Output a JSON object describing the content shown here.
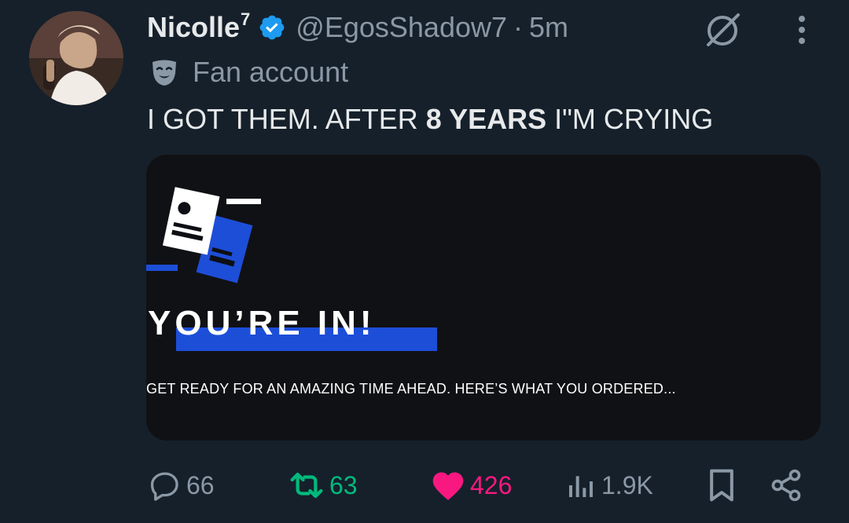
{
  "tweet": {
    "author": {
      "name": "Nicolle",
      "name_sup": "7",
      "handle": "@EgosShadow7",
      "separator": "·",
      "time": "5m"
    },
    "label": "Fan account",
    "text": {
      "before": "I GOT THEM. AFTER ",
      "bold": "8 YEARS",
      "after": " I\"M CRYING"
    },
    "card": {
      "title": "YOU’RE IN!",
      "subtitle": "GET READY FOR AN AMAZING TIME AHEAD. HERE’S WHAT YOU ORDERED..."
    },
    "metrics": {
      "replies": "66",
      "retweets": "63",
      "likes": "426",
      "views": "1.9K"
    }
  },
  "icons": {
    "verified": "verified-badge-icon",
    "grok": "grok-icon",
    "more": "more-vertical-icon",
    "label": "theater-mask-icon",
    "reply": "reply-icon",
    "retweet": "retweet-icon",
    "like": "heart-icon",
    "views": "views-icon",
    "bookmark": "bookmark-icon",
    "share": "share-icon"
  },
  "colors": {
    "background": "#15202b",
    "verified": "#1d9bf0",
    "retweet": "#00ba7c",
    "like": "#f91880",
    "muted": "#8b98a5",
    "card_accent": "#1d4ed8"
  }
}
